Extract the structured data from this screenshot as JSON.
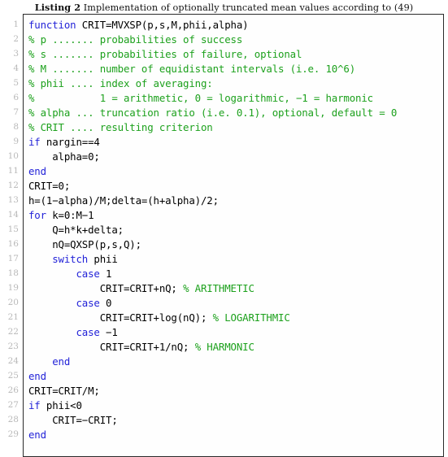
{
  "caption": {
    "label": "Listing 2",
    "text": "Implementation of optionally truncated mean values according to (49)"
  },
  "colors": {
    "keyword": "#2323d8",
    "comment": "#1da11d",
    "code": "#000000",
    "line_number": "#b9b9b9",
    "frame": "#2a2a2a",
    "background": "#ffffff"
  },
  "listing": {
    "language": "MATLAB",
    "first_line_number": 1,
    "line_count": 29,
    "line_numbers": [
      1,
      2,
      3,
      4,
      5,
      6,
      7,
      8,
      9,
      10,
      11,
      12,
      13,
      14,
      15,
      16,
      17,
      18,
      19,
      20,
      21,
      22,
      23,
      24,
      25,
      26,
      27,
      28,
      29
    ],
    "lines": [
      {
        "n": 1,
        "tokens": [
          {
            "t": "kw",
            "v": "function"
          },
          {
            "t": "txt",
            "v": " CRIT=MVXSP(p,s,M,phii,alpha)"
          }
        ]
      },
      {
        "n": 2,
        "tokens": [
          {
            "t": "cmt",
            "v": "% p ....... probabilities of success"
          }
        ]
      },
      {
        "n": 3,
        "tokens": [
          {
            "t": "cmt",
            "v": "% s ....... probabilities of failure, optional"
          }
        ]
      },
      {
        "n": 4,
        "tokens": [
          {
            "t": "cmt",
            "v": "% M ....... number of equidistant intervals (i.e. 10^6)"
          }
        ]
      },
      {
        "n": 5,
        "tokens": [
          {
            "t": "cmt",
            "v": "% phii .... index of averaging:"
          }
        ]
      },
      {
        "n": 6,
        "tokens": [
          {
            "t": "cmt",
            "v": "%           1 = arithmetic, 0 = logarithmic, −1 = harmonic"
          }
        ]
      },
      {
        "n": 7,
        "tokens": [
          {
            "t": "cmt",
            "v": "% alpha ... truncation ratio (i.e. 0.1), optional, default = 0"
          }
        ]
      },
      {
        "n": 8,
        "tokens": [
          {
            "t": "cmt",
            "v": "% CRIT .... resulting criterion"
          }
        ]
      },
      {
        "n": 9,
        "tokens": [
          {
            "t": "kw",
            "v": "if"
          },
          {
            "t": "txt",
            "v": " nargin==4"
          }
        ]
      },
      {
        "n": 10,
        "tokens": [
          {
            "t": "txt",
            "v": "    alpha=0;"
          }
        ]
      },
      {
        "n": 11,
        "tokens": [
          {
            "t": "kw",
            "v": "end"
          }
        ]
      },
      {
        "n": 12,
        "tokens": [
          {
            "t": "txt",
            "v": "CRIT=0;"
          }
        ]
      },
      {
        "n": 13,
        "tokens": [
          {
            "t": "txt",
            "v": "h=(1−alpha)/M;delta=(h+alpha)/2;"
          }
        ]
      },
      {
        "n": 14,
        "tokens": [
          {
            "t": "kw",
            "v": "for"
          },
          {
            "t": "txt",
            "v": " k=0:M−1"
          }
        ]
      },
      {
        "n": 15,
        "tokens": [
          {
            "t": "txt",
            "v": "    Q=h*k+delta;"
          }
        ]
      },
      {
        "n": 16,
        "tokens": [
          {
            "t": "txt",
            "v": "    nQ=QXSP(p,s,Q);"
          }
        ]
      },
      {
        "n": 17,
        "tokens": [
          {
            "t": "txt",
            "v": "    "
          },
          {
            "t": "kw",
            "v": "switch"
          },
          {
            "t": "txt",
            "v": " phii"
          }
        ]
      },
      {
        "n": 18,
        "tokens": [
          {
            "t": "txt",
            "v": "        "
          },
          {
            "t": "kw",
            "v": "case"
          },
          {
            "t": "txt",
            "v": " 1"
          }
        ]
      },
      {
        "n": 19,
        "tokens": [
          {
            "t": "txt",
            "v": "            CRIT=CRIT+nQ; "
          },
          {
            "t": "cmt",
            "v": "% ARITHMETIC"
          }
        ]
      },
      {
        "n": 20,
        "tokens": [
          {
            "t": "txt",
            "v": "        "
          },
          {
            "t": "kw",
            "v": "case"
          },
          {
            "t": "txt",
            "v": " 0"
          }
        ]
      },
      {
        "n": 21,
        "tokens": [
          {
            "t": "txt",
            "v": "            CRIT=CRIT+log(nQ); "
          },
          {
            "t": "cmt",
            "v": "% LOGARITHMIC"
          }
        ]
      },
      {
        "n": 22,
        "tokens": [
          {
            "t": "txt",
            "v": "        "
          },
          {
            "t": "kw",
            "v": "case"
          },
          {
            "t": "txt",
            "v": " −1"
          }
        ]
      },
      {
        "n": 23,
        "tokens": [
          {
            "t": "txt",
            "v": "            CRIT=CRIT+1/nQ; "
          },
          {
            "t": "cmt",
            "v": "% HARMONIC"
          }
        ]
      },
      {
        "n": 24,
        "tokens": [
          {
            "t": "txt",
            "v": "    "
          },
          {
            "t": "kw",
            "v": "end"
          }
        ]
      },
      {
        "n": 25,
        "tokens": [
          {
            "t": "kw",
            "v": "end"
          }
        ]
      },
      {
        "n": 26,
        "tokens": [
          {
            "t": "txt",
            "v": "CRIT=CRIT/M;"
          }
        ]
      },
      {
        "n": 27,
        "tokens": [
          {
            "t": "kw",
            "v": "if"
          },
          {
            "t": "txt",
            "v": " phii<0"
          }
        ]
      },
      {
        "n": 28,
        "tokens": [
          {
            "t": "txt",
            "v": "    CRIT=−CRIT;"
          }
        ]
      },
      {
        "n": 29,
        "tokens": [
          {
            "t": "kw",
            "v": "end"
          }
        ]
      }
    ]
  }
}
